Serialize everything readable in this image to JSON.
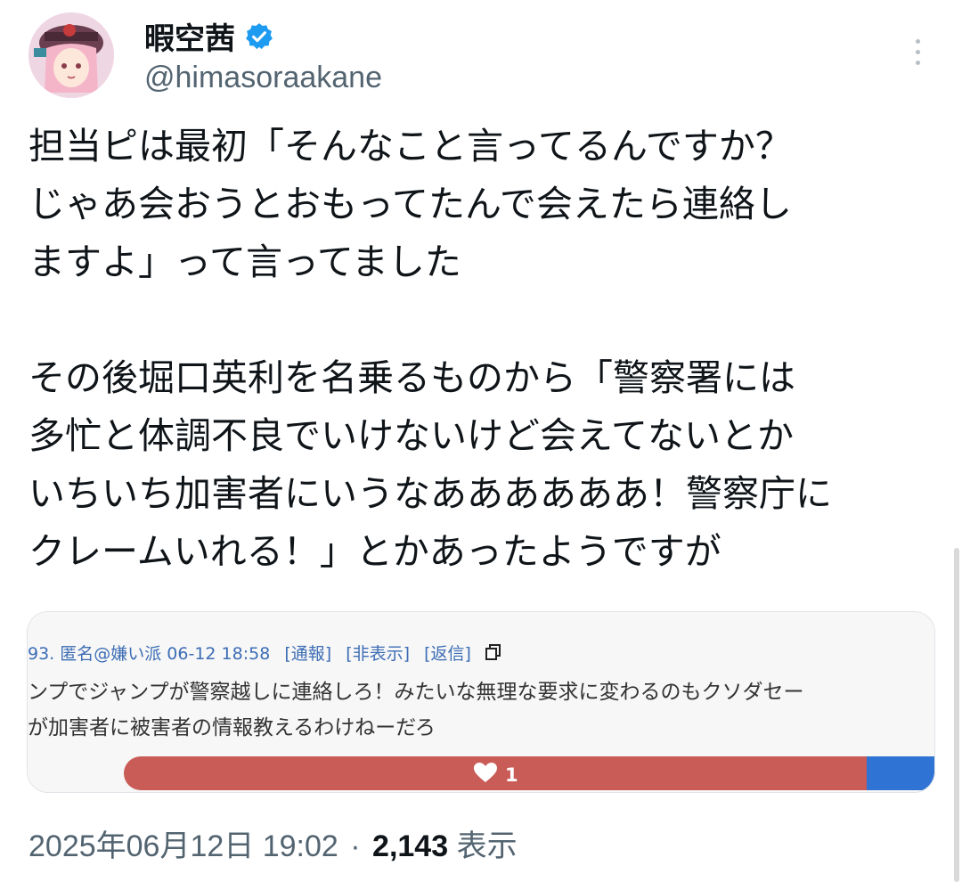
{
  "user": {
    "display_name": "暇空茜",
    "handle": "@himasoraakane",
    "verified": true,
    "verified_color": "#1d9bf0"
  },
  "tweet": {
    "lines": [
      "担当ピは最初「そんなこと言ってるんですか？",
      "じゃあ会おうとおもってたんで会えたら連絡し",
      "ますよ」って言ってました",
      "",
      "その後堀口英利を名乗るものから「警察署には",
      "多忙と体調不良でいけないけど会えてないとか",
      "いちいち加害者にいうなああああああ！警察庁に",
      "クレームいれる！」とかあったようですが"
    ]
  },
  "embedded_post": {
    "meta": "93. 匿名@嫌い派 06-12 18:58",
    "report_link": "[通報]",
    "hide_link": "[非表示]",
    "reply_link": "[返信]",
    "line1": "ンプでジャンプが警察越しに連絡しろ！みたいな無理な要求に変わるのもクソダセー",
    "line2": "が加害者に被害者の情報教えるわけねーだろ",
    "like_count": "1",
    "like_bar_color": "#c95c57",
    "dislike_bar_color": "#2f74d4"
  },
  "footer": {
    "timestamp": "2025年06月12日 19:02",
    "separator": "·",
    "views_count": "2,143",
    "views_label": "表示"
  },
  "icons": {
    "more": "more-vertical-icon",
    "verified": "verified-badge-icon",
    "copy": "copy-icon",
    "heart": "heart-icon"
  }
}
